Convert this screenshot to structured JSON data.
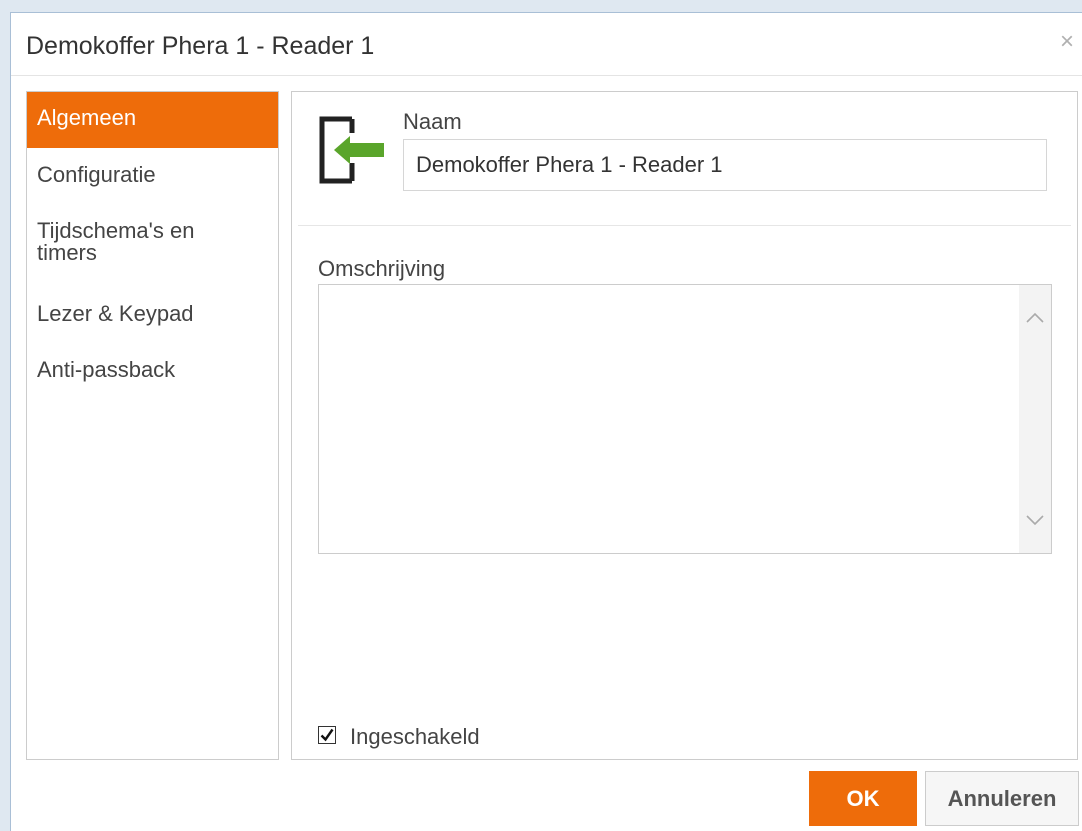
{
  "window": {
    "title": "Demokoffer Phera 1 - Reader 1",
    "close_symbol": "×"
  },
  "sidebar": {
    "items": [
      {
        "label": "Algemeen",
        "active": true
      },
      {
        "label": "Configuratie",
        "active": false
      },
      {
        "label": "Tijdschema's en timers",
        "active": false
      },
      {
        "label": "Lezer & Keypad",
        "active": false
      },
      {
        "label": "Anti-passback",
        "active": false
      }
    ]
  },
  "general": {
    "icon": "reader-entry-icon",
    "name_label": "Naam",
    "name_value": "Demokoffer Phera 1 - Reader 1",
    "description_label": "Omschrijving",
    "description_value": "",
    "enabled_label": "Ingeschakeld",
    "enabled": true
  },
  "footer": {
    "ok_label": "OK",
    "cancel_label": "Annuleren"
  },
  "colors": {
    "accent": "#ee6c0a",
    "arrow_green": "#5aa52b",
    "border": "#cccccc"
  }
}
